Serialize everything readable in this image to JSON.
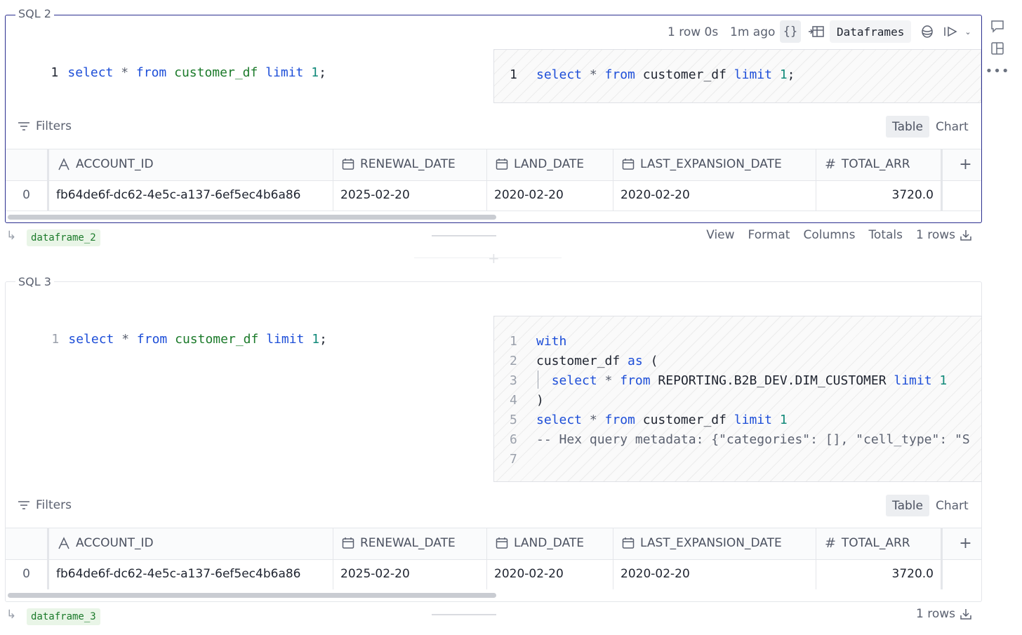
{
  "cells": [
    {
      "label": "SQL 2",
      "code": [
        "1",
        "select",
        "*",
        "from",
        "customer_df",
        "limit",
        "1",
        ";"
      ],
      "toolbar": {
        "rows_info": "1 row 0s",
        "time_ago": "1m ago",
        "dataframes_label": "Dataframes"
      },
      "compiled_preview": {
        "lines": [
          {
            "num": "1",
            "tokens": [
              {
                "t": "select",
                "c": "kw"
              },
              {
                "t": " * ",
                "c": "op"
              },
              {
                "t": "from",
                "c": "kw"
              },
              {
                "t": " customer_df ",
                "c": "plainc"
              },
              {
                "t": "limit",
                "c": "kw"
              },
              {
                "t": " 1",
                "c": "num"
              },
              {
                "t": ";",
                "c": "plainc"
              }
            ]
          }
        ]
      },
      "filters_label": "Filters",
      "tabs": [
        "Table",
        "Chart"
      ],
      "table": {
        "columns": [
          {
            "name": "ACCOUNT_ID",
            "icon": "text-type-icon"
          },
          {
            "name": "RENEWAL_DATE",
            "icon": "calendar-icon"
          },
          {
            "name": "LAND_DATE",
            "icon": "calendar-icon"
          },
          {
            "name": "LAST_EXPANSION_DATE",
            "icon": "calendar-icon"
          },
          {
            "name": "TOTAL_ARR",
            "icon": "hash-icon"
          }
        ],
        "rows": [
          {
            "index": "0",
            "values": [
              "fb64de6f-dc62-4e5c-a137-6ef5ec4b6a86",
              "2025-02-20",
              "2020-02-20",
              "2020-02-20",
              "3720.0"
            ]
          }
        ]
      },
      "footer": {
        "dataframe": "dataframe_2",
        "actions": [
          "View",
          "Format",
          "Columns",
          "Totals"
        ],
        "row_count": "1 rows"
      }
    },
    {
      "label": "SQL 3",
      "code": [
        "1",
        "select",
        "*",
        "from",
        "customer_df",
        "limit",
        "1",
        ";"
      ],
      "compiled_preview": {
        "lines": [
          {
            "num": "1",
            "tokens": [
              {
                "t": "with",
                "c": "kw"
              }
            ]
          },
          {
            "num": "2",
            "tokens": [
              {
                "t": "customer_df ",
                "c": "plainc"
              },
              {
                "t": "as",
                "c": "kw"
              },
              {
                "t": " (",
                "c": "plainc"
              }
            ]
          },
          {
            "num": "3",
            "tokens": [
              {
                "t": "  ",
                "c": "plainc"
              },
              {
                "t": "select",
                "c": "kw"
              },
              {
                "t": " * ",
                "c": "op"
              },
              {
                "t": "from",
                "c": "kw"
              },
              {
                "t": " REPORTING.B2B_DEV.DIM_CUSTOMER ",
                "c": "plainc"
              },
              {
                "t": "limit",
                "c": "kw"
              },
              {
                "t": " 1",
                "c": "num"
              }
            ]
          },
          {
            "num": "4",
            "tokens": [
              {
                "t": ")",
                "c": "plainc"
              }
            ]
          },
          {
            "num": "5",
            "tokens": [
              {
                "t": "select",
                "c": "kw"
              },
              {
                "t": " * ",
                "c": "op"
              },
              {
                "t": "from",
                "c": "kw"
              },
              {
                "t": " customer_df ",
                "c": "plainc"
              },
              {
                "t": "limit",
                "c": "kw"
              },
              {
                "t": " 1",
                "c": "num"
              }
            ]
          },
          {
            "num": "6",
            "tokens": [
              {
                "t": "-- Hex query metadata: {\"categories\": [], \"cell_type\": \"S",
                "c": "cm"
              }
            ]
          },
          {
            "num": "7",
            "tokens": []
          }
        ]
      },
      "filters_label": "Filters",
      "tabs": [
        "Table",
        "Chart"
      ],
      "table": {
        "columns": [
          {
            "name": "ACCOUNT_ID",
            "icon": "text-type-icon"
          },
          {
            "name": "RENEWAL_DATE",
            "icon": "calendar-icon"
          },
          {
            "name": "LAND_DATE",
            "icon": "calendar-icon"
          },
          {
            "name": "LAST_EXPANSION_DATE",
            "icon": "calendar-icon"
          },
          {
            "name": "TOTAL_ARR",
            "icon": "hash-icon"
          }
        ],
        "rows": [
          {
            "index": "0",
            "values": [
              "fb64de6f-dc62-4e5c-a137-6ef5ec4b6a86",
              "2025-02-20",
              "2020-02-20",
              "2020-02-20",
              "3720.0"
            ]
          }
        ]
      },
      "footer": {
        "dataframe": "dataframe_3",
        "row_count": "1 rows"
      }
    }
  ],
  "side_icons": [
    "comment-icon",
    "layout-icon",
    "more-icon"
  ]
}
